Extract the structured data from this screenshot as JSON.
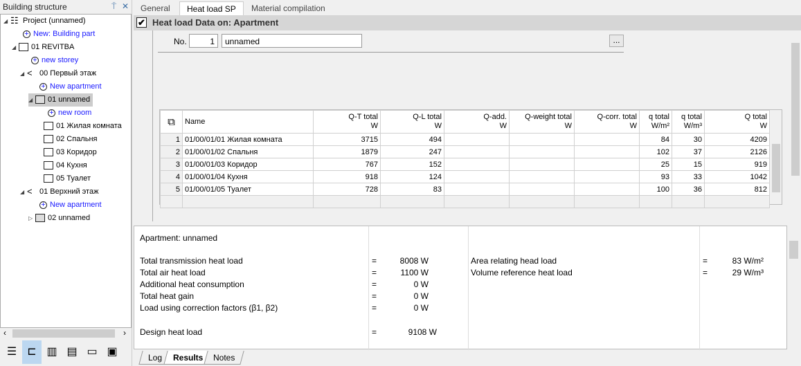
{
  "left_panel": {
    "title": "Building structure",
    "pin": "⍑",
    "close": "✕",
    "tree": [
      {
        "label": "Project (unnamed)",
        "level": 0,
        "type": "project",
        "arrow": "◢"
      },
      {
        "label": "New: Building part",
        "level": 1,
        "type": "add"
      },
      {
        "label": "01 REVITBA",
        "level": 1,
        "type": "building",
        "arrow": "◢"
      },
      {
        "label": "new storey",
        "level": 2,
        "type": "add"
      },
      {
        "label": "00 Первый этаж",
        "level": 2,
        "type": "storey",
        "arrow": "◢"
      },
      {
        "label": "New apartment",
        "level": 3,
        "type": "add"
      },
      {
        "label": "01 unnamed",
        "level": 3,
        "type": "apartment",
        "arrow": "◢",
        "selected": true
      },
      {
        "label": "new room",
        "level": 4,
        "type": "add"
      },
      {
        "label": "01 Жилая комната",
        "level": 4,
        "type": "room"
      },
      {
        "label": "02 Спальня",
        "level": 4,
        "type": "room"
      },
      {
        "label": "03 Коридор",
        "level": 4,
        "type": "room"
      },
      {
        "label": "04 Кухня",
        "level": 4,
        "type": "room"
      },
      {
        "label": "05 Туалет",
        "level": 4,
        "type": "room"
      },
      {
        "label": "01 Верхний этаж",
        "level": 2,
        "type": "storey",
        "arrow": "◢"
      },
      {
        "label": "New apartment",
        "level": 3,
        "type": "add"
      },
      {
        "label": "02 unnamed",
        "level": 3,
        "type": "apartment",
        "arrow": "▷"
      }
    ],
    "bottom_icons": [
      "list-icon",
      "structure-icon",
      "radiator-icon",
      "document-icon",
      "layers-icon",
      "card-icon"
    ]
  },
  "tabs": [
    {
      "label": "General"
    },
    {
      "label": "Heat load SP",
      "active": true
    },
    {
      "label": "Material compilation"
    }
  ],
  "header": {
    "title": "Heat load Data on: Apartment",
    "checked": true
  },
  "form": {
    "no_label": "No.",
    "no_value": "1",
    "name_value": "unnamed",
    "more_button": "..."
  },
  "grid": {
    "columns": [
      [
        "Name",
        ""
      ],
      [
        "Q-T total",
        "W"
      ],
      [
        "Q-L total",
        "W"
      ],
      [
        "Q-add.",
        "W"
      ],
      [
        "Q-weight total",
        "W"
      ],
      [
        "Q-corr. total",
        "W"
      ],
      [
        "q total",
        "W/m²"
      ],
      [
        "q total",
        "W/m³"
      ],
      [
        "Q total",
        "W"
      ]
    ],
    "rows": [
      [
        "1",
        "01/00/01/01 Жилая комната",
        "3715",
        "494",
        "",
        "",
        "",
        "84",
        "30",
        "4209"
      ],
      [
        "2",
        "01/00/01/02 Спальня",
        "1879",
        "247",
        "",
        "",
        "",
        "102",
        "37",
        "2126"
      ],
      [
        "3",
        "01/00/01/03 Коридор",
        "767",
        "152",
        "",
        "",
        "",
        "25",
        "15",
        "919"
      ],
      [
        "4",
        "01/00/01/04 Кухня",
        "918",
        "124",
        "",
        "",
        "",
        "93",
        "33",
        "1042"
      ],
      [
        "5",
        "01/00/01/05 Туалет",
        "728",
        "83",
        "",
        "",
        "",
        "100",
        "36",
        "812"
      ]
    ]
  },
  "results": {
    "title": "Apartment: unnamed",
    "left": [
      {
        "label": "Total transmission heat load",
        "eq": "=",
        "value": "8008 W"
      },
      {
        "label": "Total air heat load",
        "eq": "=",
        "value": "1100 W"
      },
      {
        "label": "Additional heat consumption",
        "eq": "=",
        "value": "0 W"
      },
      {
        "label": "Total heat gain",
        "eq": "=",
        "value": "0 W"
      },
      {
        "label": "Load using correction factors (β1, β2)",
        "eq": "=",
        "value": "0 W"
      }
    ],
    "design": {
      "label": "Design heat load",
      "eq": "=",
      "value": "9108 W"
    },
    "right": [
      {
        "label": "Area relating head load",
        "eq": "=",
        "value": "83 W/m²"
      },
      {
        "label": "Volume reference heat load",
        "eq": "=",
        "value": "29 W/m³"
      }
    ]
  },
  "bottom_tabs": [
    {
      "label": "Log"
    },
    {
      "label": "Results",
      "active": true
    },
    {
      "label": "Notes"
    }
  ]
}
